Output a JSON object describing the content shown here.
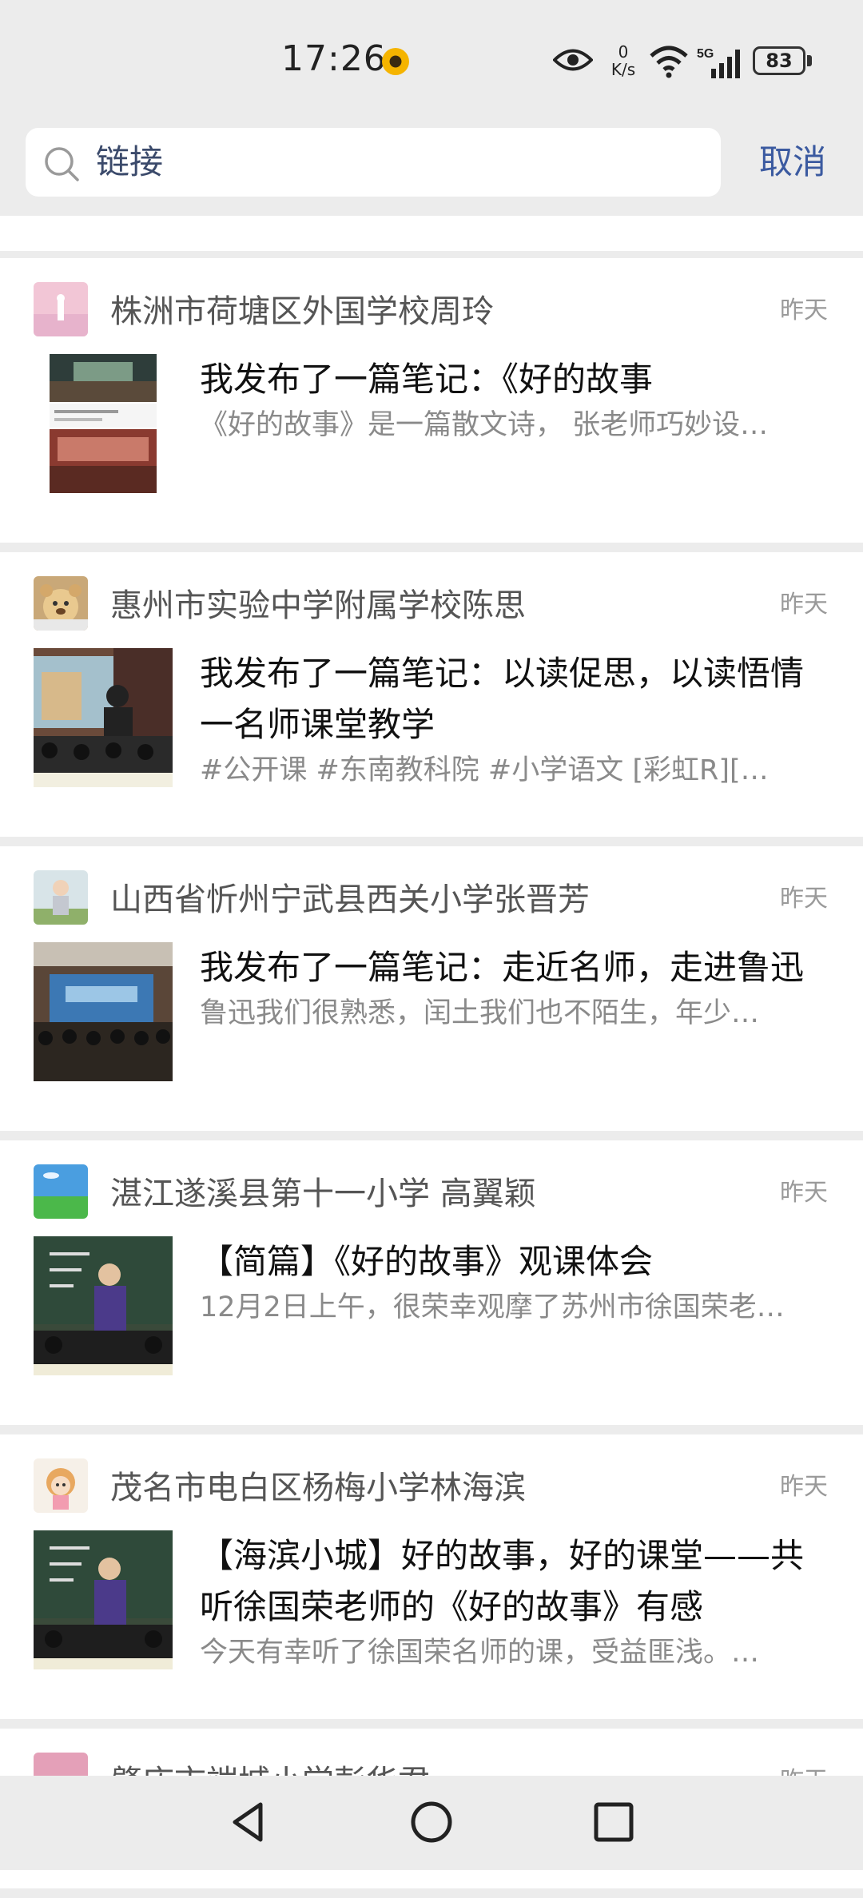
{
  "status_bar": {
    "time": "17:26",
    "net_speed_value": "0",
    "net_speed_unit": "K/s",
    "network": "5G",
    "battery": "83"
  },
  "search": {
    "query": "链接",
    "cancel_label": "取消"
  },
  "colors": {
    "background": "#ececec",
    "card": "#ffffff",
    "accent": "#3b5aa0"
  },
  "posts": [
    {
      "author": "株洲市荷塘区外国学校周玲",
      "time": "昨天",
      "title": "我发布了一篇笔记：《好的故事",
      "snippet": "《好的故事》是一篇散文诗， 张老师巧妙设…",
      "avatar_icon": "pink-sky-avatar",
      "thumb_icon": "classroom-collage-thumb"
    },
    {
      "author": "惠州市实验中学附属学校陈思",
      "time": "昨天",
      "title": "我发布了一篇笔记：以读促思，以读悟情一名师课堂教学",
      "snippet": "#公开课 #东南教科院 #小学语文 [彩虹R][…",
      "avatar_icon": "bear-avatar",
      "thumb_icon": "lecture-stage-thumb"
    },
    {
      "author": "山西省忻州宁武县西关小学张晋芳",
      "time": "昨天",
      "title": "我发布了一篇笔记：走近名师，走进鲁迅",
      "snippet": "鲁迅我们很熟悉，闰土我们也不陌生，年少…",
      "avatar_icon": "child-avatar",
      "thumb_icon": "auditorium-thumb"
    },
    {
      "author": "湛江遂溪县第十一小学  高翼颖",
      "time": "昨天",
      "title": "【简篇】《好的故事》观课体会",
      "snippet": "12月2日上午，很荣幸观摩了苏州市徐国荣老…",
      "avatar_icon": "grassland-avatar",
      "thumb_icon": "teacher-blackboard-thumb"
    },
    {
      "author": "茂名市电白区杨梅小学林海滨",
      "time": "昨天",
      "title": "【海滨小城】好的故事，好的课堂——共听徐国荣老师的《好的故事》有感",
      "snippet": "今天有幸听了徐国荣名师的课，受益匪浅。…",
      "avatar_icon": "cartoon-girl-avatar",
      "thumb_icon": "teacher-blackboard-thumb"
    },
    {
      "author": "肇庆市端城小学彭华君",
      "time": "昨天",
      "title": "",
      "snippet": "",
      "avatar_icon": "pink-avatar",
      "thumb_icon": ""
    }
  ]
}
